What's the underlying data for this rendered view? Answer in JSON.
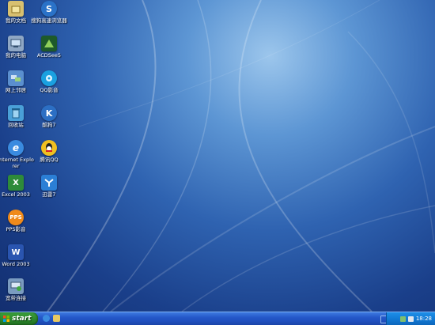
{
  "desktop": {
    "icons": [
      {
        "label": "我的文档",
        "icon": "my-documents-icon",
        "color": "#d8c070"
      },
      {
        "label": "搜狗高速浏览器",
        "icon": "sogou-browser-icon",
        "color": "#2a72c8"
      },
      {
        "label": "我的电脑",
        "icon": "my-computer-icon",
        "color": "#8fa7c4"
      },
      {
        "label": "ACDSee5",
        "icon": "acdsee-icon",
        "color": "#1d5a2a"
      },
      {
        "label": "网上邻居",
        "icon": "network-places-icon",
        "color": "#5a8fcf"
      },
      {
        "label": "QQ影音",
        "icon": "qq-player-icon",
        "color": "#1aa0e0"
      },
      {
        "label": "回收站",
        "icon": "recycle-bin-icon",
        "color": "#4aa0d8"
      },
      {
        "label": "酷狗7",
        "icon": "kugou-icon",
        "color": "#2c6fc4"
      },
      {
        "label": "Internet Explorer",
        "icon": "internet-explorer-icon",
        "color": "#3a8be0"
      },
      {
        "label": "腾讯QQ",
        "icon": "qq-icon",
        "color": "#f0c020"
      },
      {
        "label": "Excel 2003",
        "icon": "excel-icon",
        "color": "#2e8b3a"
      },
      {
        "label": "迅雷7",
        "icon": "thunder-icon",
        "color": "#2b7fd6"
      },
      {
        "label": "PPS影音",
        "icon": "pps-icon",
        "color": "#f08a1a"
      },
      {
        "label": "Word 2003",
        "icon": "word-icon",
        "color": "#2a55b0"
      },
      {
        "label": "宽带连接",
        "icon": "broadband-connection-icon",
        "color": "#7a9bc0"
      }
    ]
  },
  "taskbar": {
    "start_label": "start",
    "quick_launch": [
      "ie-quicklaunch-icon",
      "folder-quicklaunch-icon"
    ],
    "tray_icons": [
      "network-tray-icon",
      "volume-tray-icon"
    ],
    "clock": "18:28"
  }
}
